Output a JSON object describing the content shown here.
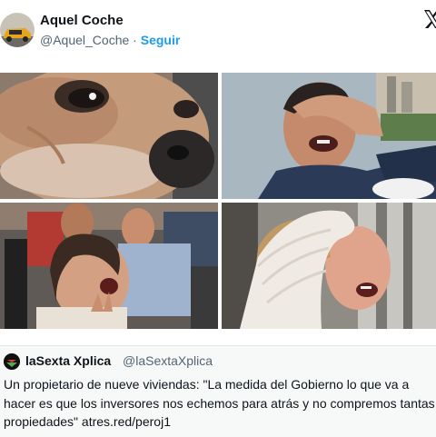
{
  "tweet": {
    "display_name": "Aquel Coche",
    "handle": "@Aquel_Coche",
    "separator": "·",
    "follow_label": "Seguir",
    "x_logo_icon": "x-logo-icon",
    "avatar_icon": "car-avatar-icon"
  },
  "media": {
    "images": [
      {
        "name": "sad-dog-photo"
      },
      {
        "name": "crying-man-photo"
      },
      {
        "name": "crying-crowd-photo"
      },
      {
        "name": "crying-woman-sweater-photo"
      }
    ]
  },
  "quote": {
    "account_name": "laSexta Xplica",
    "account_handle": "@laSextaXplica",
    "avatar_icon": "lasexta-logo-icon",
    "text": "Un propietario de nueve viviendas: \"La medida del Gobierno lo que va a hacer es que los inversores nos echemos para atrás y no compremos tantas propiedades\" atres.red/peroj1"
  },
  "colors": {
    "link": "#1d9bf0",
    "secondary_text": "#536471",
    "primary_text": "#0f1419"
  }
}
